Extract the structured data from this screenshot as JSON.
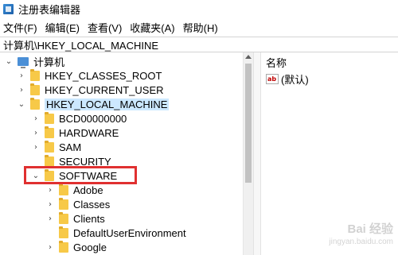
{
  "window": {
    "title": "注册表编辑器",
    "icon": "regedit-icon"
  },
  "menu": [
    {
      "label": "文件(F)"
    },
    {
      "label": "编辑(E)"
    },
    {
      "label": "查看(V)"
    },
    {
      "label": "收藏夹(A)"
    },
    {
      "label": "帮助(H)"
    }
  ],
  "address": {
    "path": "计算机\\HKEY_LOCAL_MACHINE"
  },
  "tree": {
    "root": {
      "label": "计算机",
      "expanded": true
    },
    "hives": [
      {
        "label": "HKEY_CLASSES_ROOT",
        "expanded": false
      },
      {
        "label": "HKEY_CURRENT_USER",
        "expanded": false
      },
      {
        "label": "HKEY_LOCAL_MACHINE",
        "expanded": true,
        "selected": true
      }
    ],
    "hklm_children": [
      {
        "label": "BCD00000000",
        "expandable": true
      },
      {
        "label": "HARDWARE",
        "expandable": true
      },
      {
        "label": "SAM",
        "expandable": true
      },
      {
        "label": "SECURITY",
        "expandable": false
      },
      {
        "label": "SOFTWARE",
        "expandable": true,
        "expanded": true,
        "highlighted": true
      }
    ],
    "software_children": [
      {
        "label": "Adobe",
        "expandable": true
      },
      {
        "label": "Classes",
        "expandable": true
      },
      {
        "label": "Clients",
        "expandable": true
      },
      {
        "label": "DefaultUserEnvironment",
        "expandable": false
      },
      {
        "label": "Google",
        "expandable": true
      }
    ]
  },
  "list": {
    "column_name": "名称",
    "values": [
      {
        "name": "(默认)",
        "icon": "string-value-icon"
      }
    ]
  },
  "colors": {
    "selection": "#cce8ff",
    "highlight_border": "#e03030",
    "folder": "#f7c948"
  },
  "watermark": {
    "line1": "Bai 经验",
    "line2": "jingyan.baidu.com"
  }
}
